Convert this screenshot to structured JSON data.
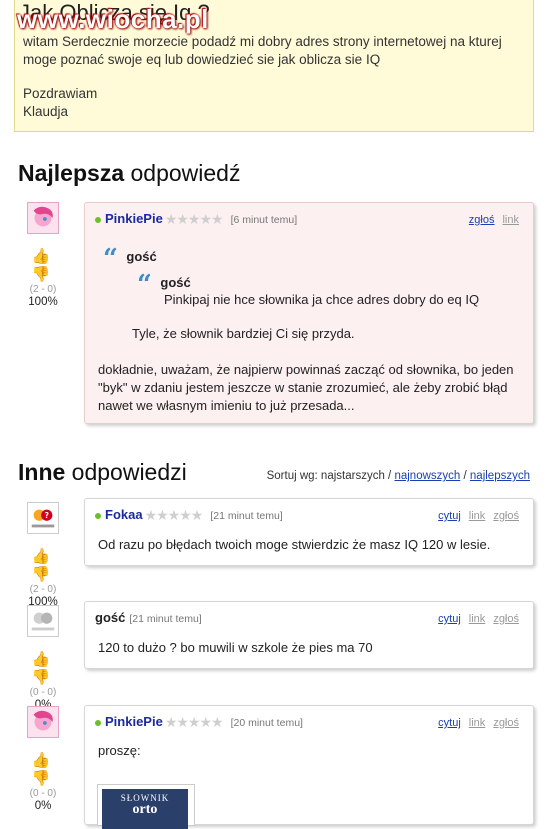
{
  "question": {
    "title": "Jak Oblicza się Iq ?",
    "watermark": "www.wiocha.pl",
    "body": "witam Serdecznie morzecie podadź mi dobry adres strony internetowej na kturej moge poznać swoje eq lub dowiedzieć sie jak oblicza sie IQ",
    "signature_1": "Pozdrawiam",
    "signature_2": "Klaudja"
  },
  "best_section": {
    "title_bold": "Najlepsza",
    "title_rest": " odpowiedź"
  },
  "best_answer": {
    "user": "PinkiePie",
    "time": "[6 minut temu]",
    "links": [
      "zgłoś",
      "link"
    ],
    "votes": "(2 - 0)",
    "percent": "100%",
    "quote_outer_user": "gość",
    "quote_inner_user": "gość",
    "quote_inner_text": "Pinkipaj nie hce słownika ja chce adres dobry do eq IQ",
    "quote_outer_text": "Tyle, że słownik bardziej Ci się przyda.",
    "body": "dokładnie, uważam, że najpierw powinnaś zacząć od słownika, bo jeden \"byk\" w zdaniu jestem jeszcze w stanie zrozumieć, ale żeby zrobić błąd nawet we własnym imieniu to już przesada..."
  },
  "other_section": {
    "title_bold": "Inne",
    "title_rest": " odpowiedzi",
    "sort_label": "Sortuj wg: najstarszych /",
    "sort_newest": "najnowszych",
    "sort_sep": "/",
    "sort_best": "najlepszych"
  },
  "answers": [
    {
      "user": "Fokaa",
      "time": "[21 minut temu]",
      "links": [
        "cytuj",
        "link",
        "zgłoś"
      ],
      "votes": "(2 - 0)",
      "percent": "100%",
      "body": "Od razu po błędach twoich moge stwierdzic że masz IQ 120 w lesie."
    },
    {
      "user": "gość",
      "time": "[21 minut temu]",
      "links": [
        "cytuj",
        "link",
        "zgłoś"
      ],
      "votes": "(0 - 0)",
      "percent": "0%",
      "body": "120 to dużo ? bo muwili w szkole że pies ma 70"
    },
    {
      "user": "PinkiePie",
      "time": "[20 minut temu]",
      "links": [
        "cytuj",
        "link",
        "zgłoś"
      ],
      "votes": "(0 - 0)",
      "percent": "0%",
      "body": "proszę:",
      "image_caption_1": "SŁOWNIK",
      "image_caption_2": "orto"
    }
  ],
  "colors": {
    "question_bg": "#fffbd8",
    "best_card_bg": "#fdf0f0",
    "username": "#1b2a9e",
    "link": "#1a3fb0",
    "online_dot": "#6cbf2a",
    "quote_icon": "#3a8fc8"
  }
}
